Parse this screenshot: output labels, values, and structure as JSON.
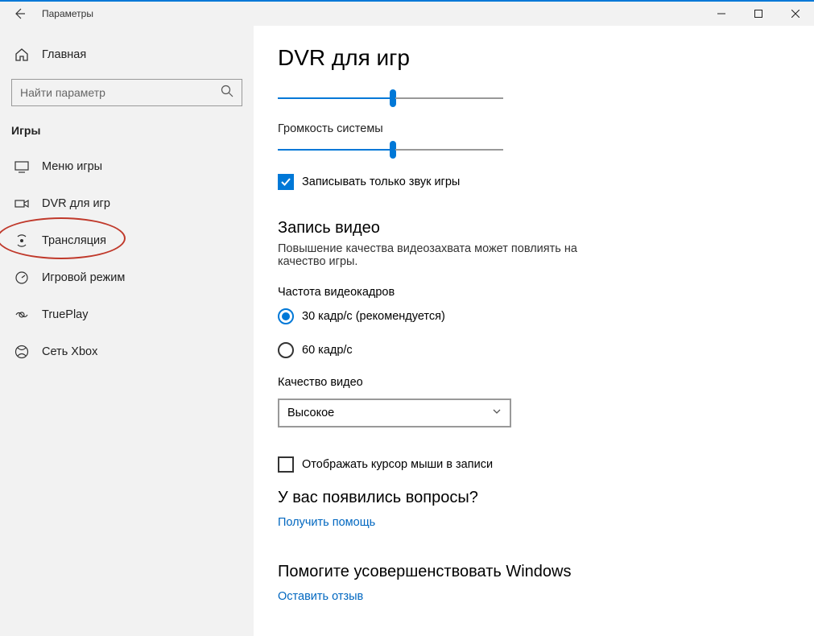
{
  "titlebar": {
    "title": "Параметры"
  },
  "sidebar": {
    "home_label": "Главная",
    "search_placeholder": "Найти параметр",
    "category_header": "Игры",
    "items": [
      {
        "label": "Меню игры"
      },
      {
        "label": "DVR для игр"
      },
      {
        "label": "Трансляция"
      },
      {
        "label": "Игровой режим"
      },
      {
        "label": "TruePlay"
      },
      {
        "label": "Сеть Xbox"
      }
    ]
  },
  "content": {
    "page_title": "DVR для игр",
    "slider1_value_pct": 50,
    "system_volume_label": "Громкость системы",
    "slider2_value_pct": 50,
    "record_only_game_audio_label": "Записывать только звук игры",
    "video_section_heading": "Запись видео",
    "video_section_desc": "Повышение качества видеозахвата может повлиять на качество игры.",
    "framerate_label": "Частота видеокадров",
    "radio30_label": "30 кадр/с (рекомендуется)",
    "radio60_label": "60 кадр/с",
    "quality_label": "Качество видео",
    "quality_value": "Высокое",
    "show_cursor_label": "Отображать курсор мыши в записи",
    "questions_heading": "У вас появились вопросы?",
    "get_help_link": "Получить помощь",
    "improve_heading": "Помогите усовершенствовать Windows",
    "feedback_link": "Оставить отзыв"
  }
}
